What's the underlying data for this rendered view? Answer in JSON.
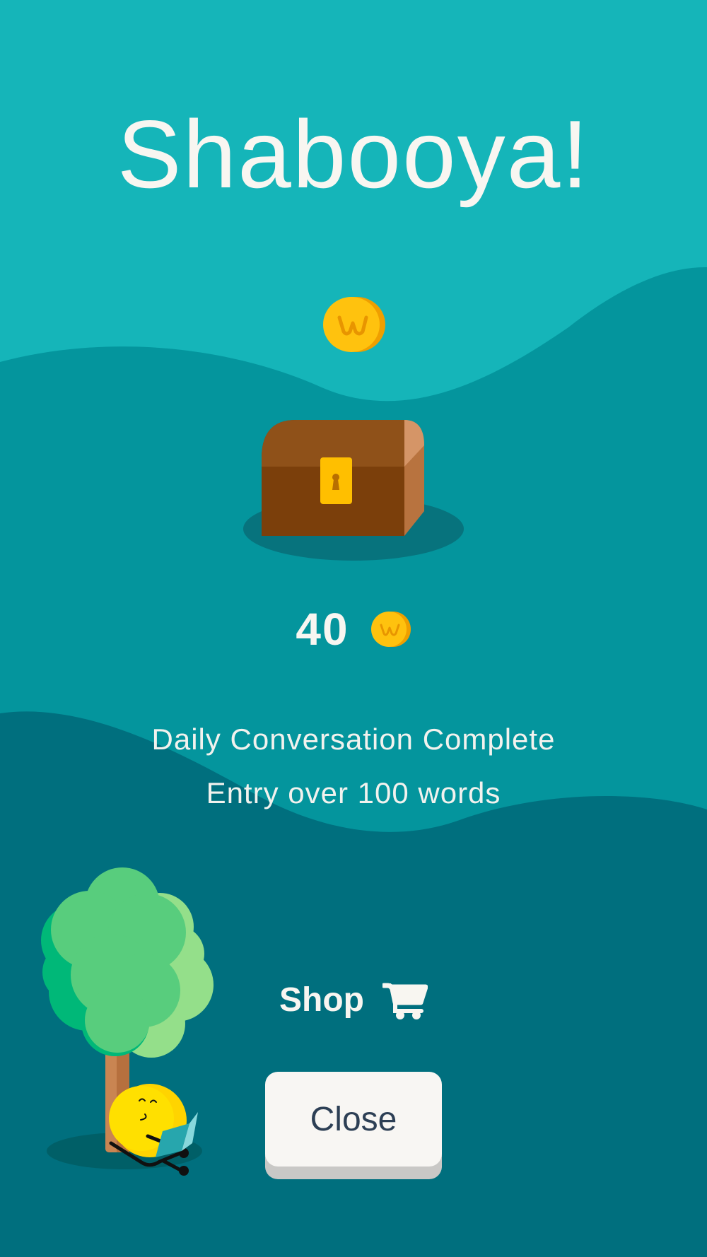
{
  "screen": {
    "title": "Shabooya!",
    "reward": {
      "amount": "40",
      "currency_icon": "coin-icon"
    },
    "achievements": [
      "Daily Conversation Complete",
      "Entry over 100 words"
    ],
    "shop": {
      "label": "Shop",
      "icon": "shopping-cart-icon"
    },
    "close_button": {
      "label": "Close"
    }
  },
  "colors": {
    "background_top": "#15b5b9",
    "background_middle": "#04959d",
    "background_bottom": "#006f7e",
    "text": "#f8f6f1",
    "button": "#f8f6f3",
    "button_text": "#2d3f55",
    "coin": "#ffc000",
    "chest": "#7b3f0b"
  }
}
